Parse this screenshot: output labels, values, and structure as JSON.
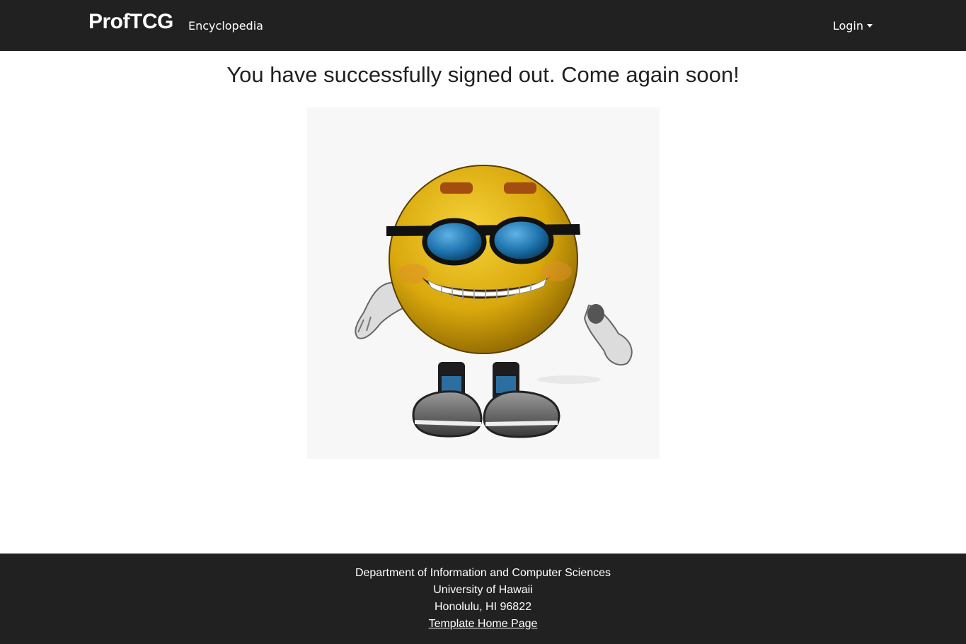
{
  "navbar": {
    "brand": "ProfTCG",
    "links": [
      {
        "label": "Encyclopedia"
      }
    ],
    "login_label": "Login"
  },
  "main": {
    "heading": "You have successfully signed out. Come again soon!",
    "image": {
      "icon": "cool-smiley-with-sunglasses"
    }
  },
  "footer": {
    "department": "Department of Information and Computer Sciences",
    "university": "University of Hawaii",
    "address": "Honolulu, HI 96822",
    "link_label": "Template Home Page"
  },
  "colors": {
    "navbar_bg": "#212121",
    "text": "#212121",
    "smiley_yellow": "#e2b40e",
    "glasses_blue": "#1a6fa8"
  }
}
